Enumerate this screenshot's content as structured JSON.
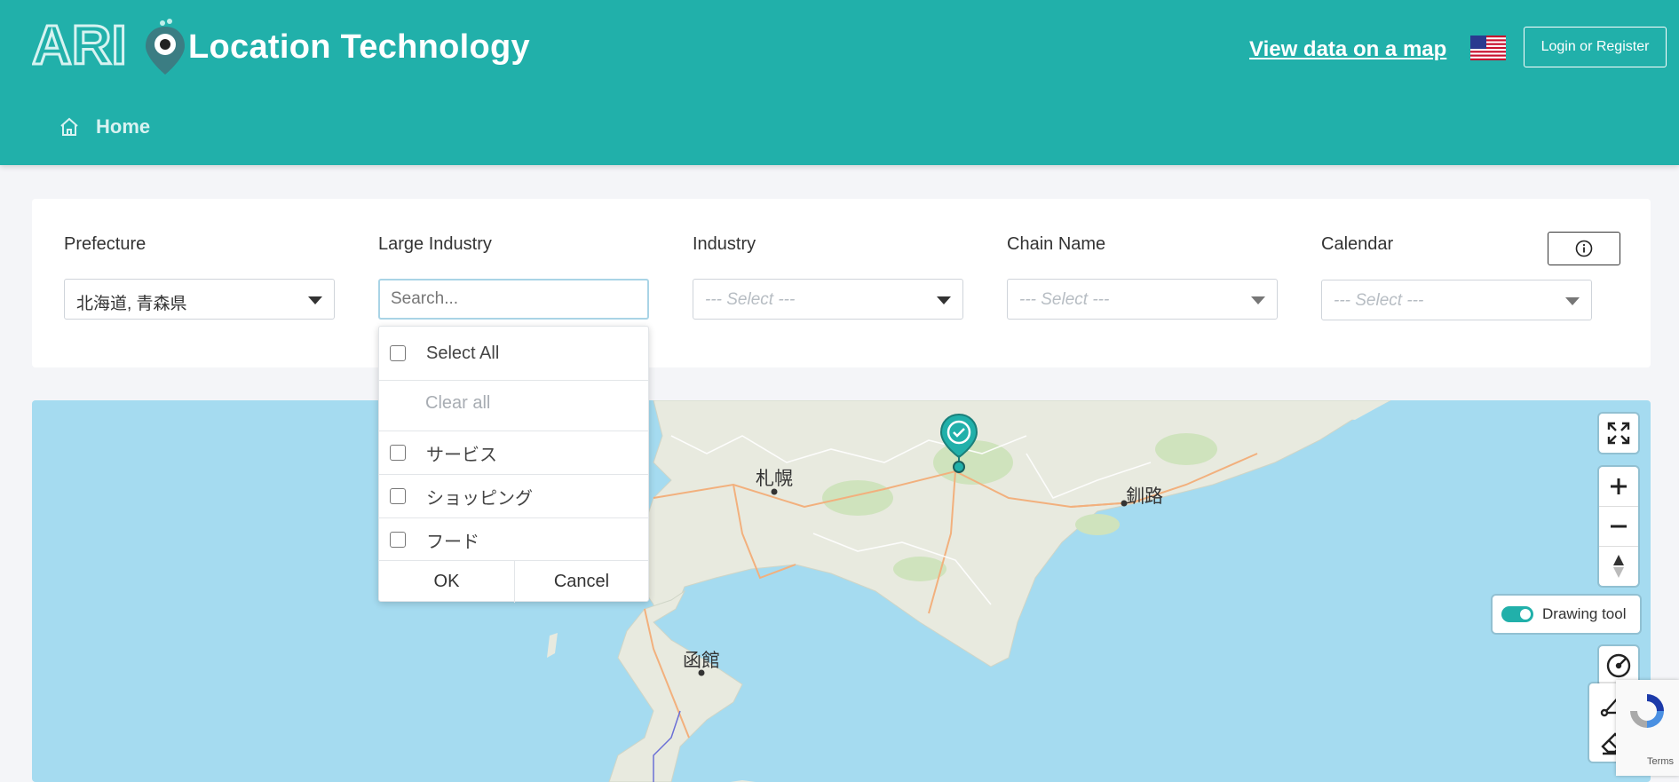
{
  "header": {
    "logo_text": "ARI",
    "brand_title": "Location Technology",
    "map_link": "View data on a map",
    "login_button": "Login or Register",
    "nav": {
      "home": "Home"
    }
  },
  "filters": {
    "prefecture": {
      "label": "Prefecture",
      "value": "北海道, 青森県"
    },
    "large_industry": {
      "label": "Large Industry",
      "placeholder": "Search..."
    },
    "industry": {
      "label": "Industry",
      "placeholder": "--- Select ---"
    },
    "chain_name": {
      "label": "Chain Name",
      "placeholder": "--- Select ---"
    },
    "calendar": {
      "label": "Calendar",
      "placeholder": "--- Select ---"
    }
  },
  "dropdown": {
    "select_all": "Select All",
    "clear_all": "Clear all",
    "options": [
      "サービス",
      "ショッピング",
      "フード"
    ],
    "ok": "OK",
    "cancel": "Cancel"
  },
  "map": {
    "cities": [
      "札幌",
      "釧路",
      "函館"
    ],
    "drawing_tool": "Drawing tool",
    "recaptcha_terms": "Terms"
  },
  "colors": {
    "accent": "#21b0aa",
    "water": "#a5dbf0",
    "land": "#e8eadf"
  }
}
